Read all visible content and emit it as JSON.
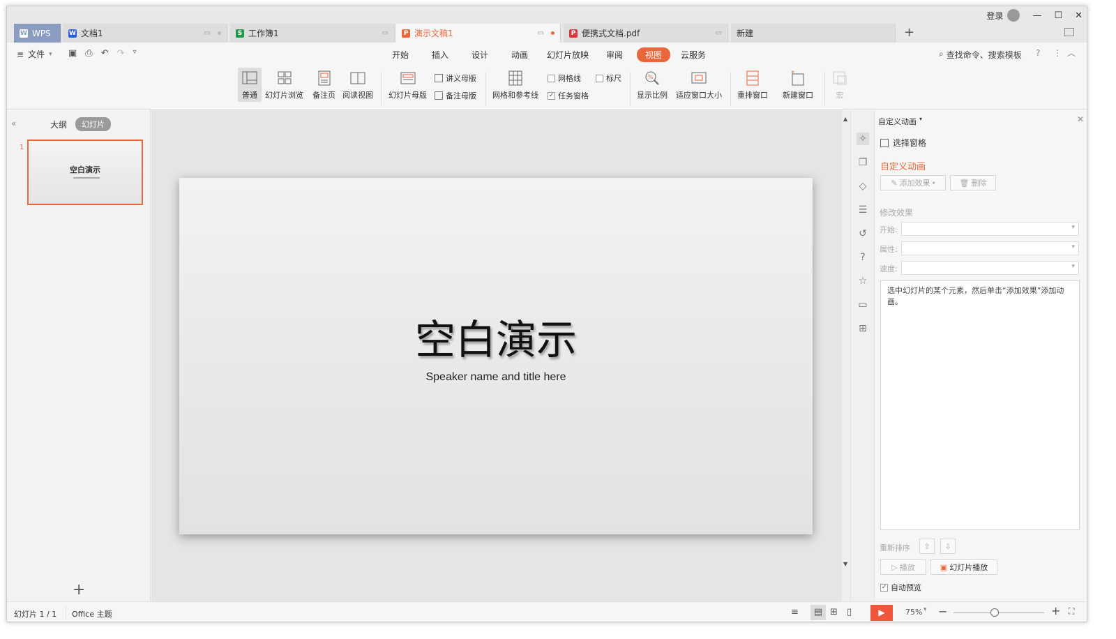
{
  "titlebar": {
    "wps_label": "WPS",
    "tabs": [
      {
        "label": "文档1",
        "icon": "W",
        "color": "#2b5fe0"
      },
      {
        "label": "工作簿1",
        "icon": "S",
        "color": "#1e9b48"
      },
      {
        "label": "演示文稿1",
        "icon": "P",
        "color": "#e9673b"
      },
      {
        "label": "便携式文档.pdf",
        "icon": "P",
        "color": "#d9363e"
      },
      {
        "label": "新建",
        "icon": "",
        "color": ""
      }
    ],
    "add_tab": "+",
    "login": "登录"
  },
  "menubar": {
    "file": "文件",
    "items": [
      "开始",
      "插入",
      "设计",
      "动画",
      "幻灯片放映",
      "审阅",
      "视图",
      "云服务"
    ],
    "selected": "视图",
    "search": "查找命令、搜索模板"
  },
  "ribbon": {
    "normal": "普通",
    "slide_browse": "幻灯片浏览",
    "notes_page": "备注页",
    "reading_view": "阅读视图",
    "slide_master": "幻灯片母版",
    "handout_master": "讲义母版",
    "notes_master": "备注母版",
    "grid_guides": "网格和参考线",
    "gridlines": "网格线",
    "ruler": "标尺",
    "task_pane": "任务窗格",
    "zoom": "显示比例",
    "fit_window": "适应窗口大小",
    "arrange": "重排窗口",
    "new_window": "新建窗口",
    "macro": "宏"
  },
  "left_panel": {
    "tab_outline": "大纲",
    "tab_slides": "幻灯片",
    "slide_number": "1",
    "thumb_title": "空白演示",
    "add": "+"
  },
  "slide": {
    "title": "空白演示",
    "subtitle": "Speaker name and title here"
  },
  "pane": {
    "header": "自定义动画",
    "select_pane": "选择窗格",
    "section_title": "自定义动画",
    "add_effect": "添加效果",
    "delete": "删除",
    "modify_effect": "修改效果",
    "start_label": "开始:",
    "property_label": "属性:",
    "speed_label": "速度:",
    "hint": "选中幻灯片的某个元素，然后单击“添加效果”添加动画。",
    "reorder": "重新排序",
    "play": "播放",
    "slideshow": "幻灯片播放",
    "auto_preview": "自动预览"
  },
  "statusbar": {
    "slide_info": "幻灯片 1 / 1",
    "theme": "Office 主题",
    "zoom": "75%",
    "zoom_value": 0.45
  },
  "colors": {
    "accent": "#e9673b",
    "play": "#f0563b"
  }
}
